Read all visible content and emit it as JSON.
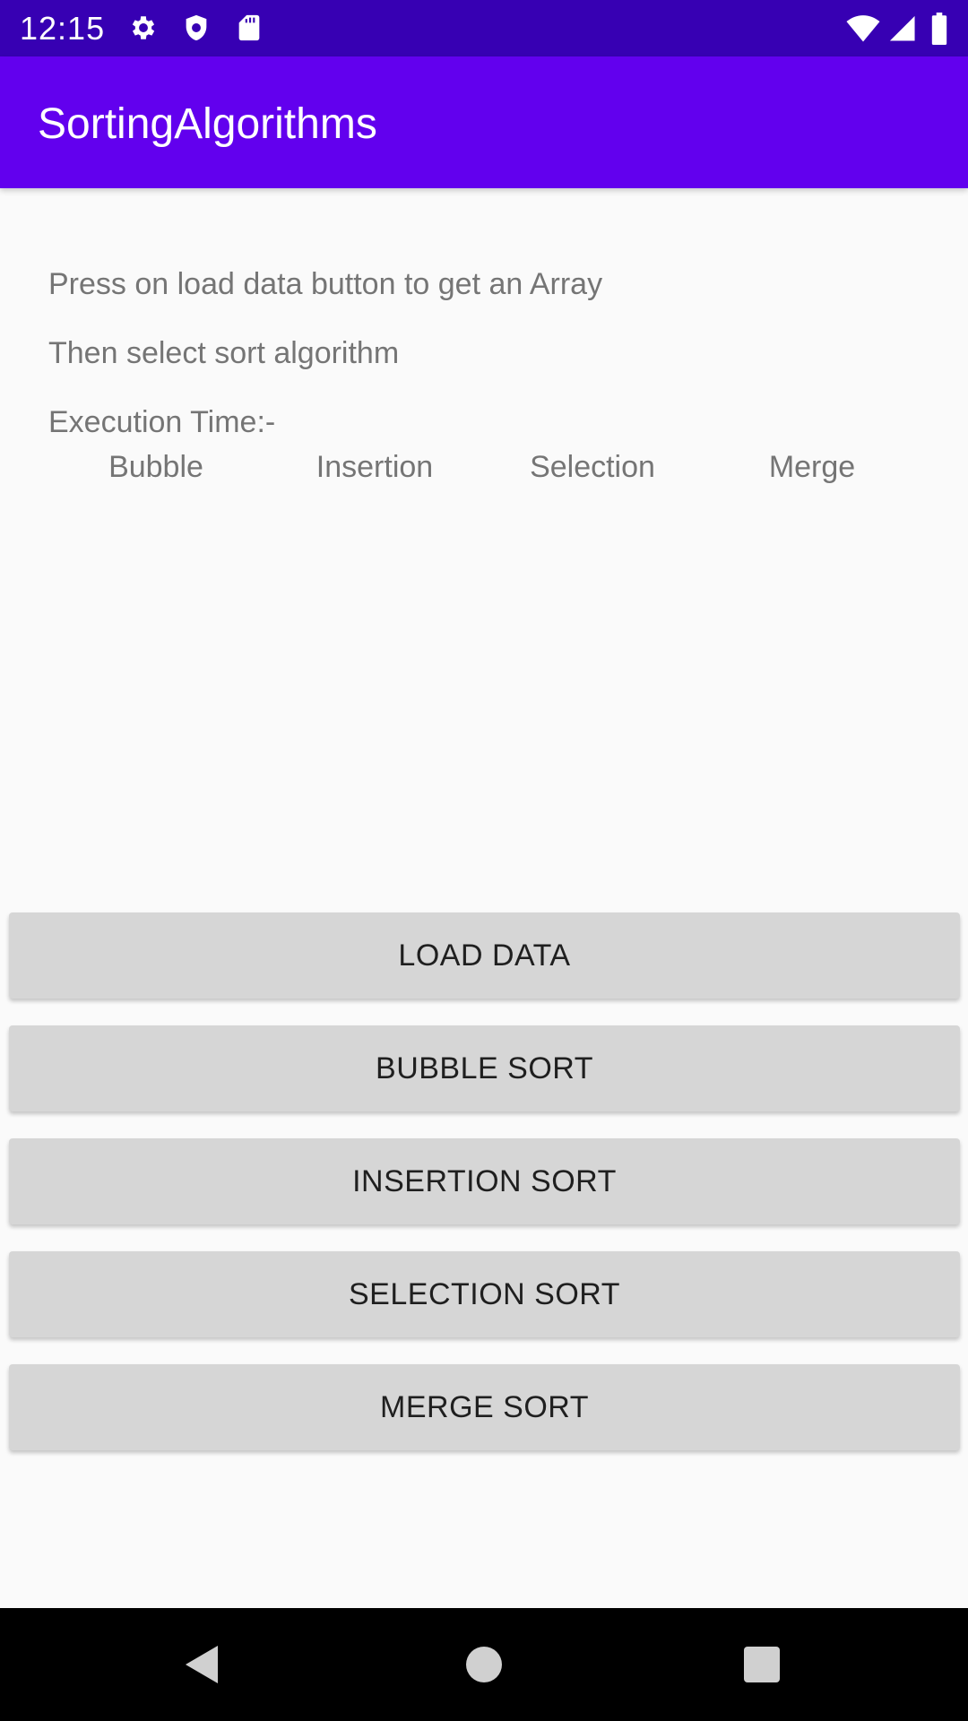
{
  "status_bar": {
    "time": "12:15",
    "icons": [
      "gear-icon",
      "shield-icon",
      "sd-card-icon",
      "wifi-icon",
      "signal-icon",
      "battery-icon"
    ]
  },
  "app_bar": {
    "title": "SortingAlgorithms"
  },
  "instructions": {
    "line1": "Press on load data button to get an Array",
    "line2": "Then select sort algorithm",
    "exec_time_label": "Execution Time:-"
  },
  "algorithms": {
    "bubble": "Bubble",
    "insertion": "Insertion",
    "selection": "Selection",
    "merge": "Merge"
  },
  "buttons": {
    "load_data": "LOAD DATA",
    "bubble_sort": "BUBBLE SORT",
    "insertion_sort": "INSERTION SORT",
    "selection_sort": "SELECTION SORT",
    "merge_sort": "MERGE SORT"
  },
  "nav_bar": {
    "icons": [
      "back-icon",
      "home-icon",
      "recents-icon"
    ]
  },
  "colors": {
    "status_bar": "#3700b3",
    "app_bar": "#6200ee",
    "button_bg": "#d6d6d6",
    "body_text": "#757575"
  }
}
